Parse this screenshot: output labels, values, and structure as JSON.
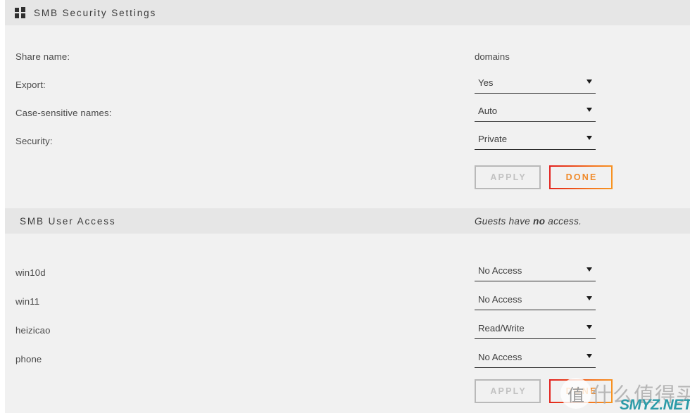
{
  "window": {
    "title": "SMB Security Settings",
    "icon": "windows-grid-icon"
  },
  "security_section": {
    "title": "SMB Security Settings",
    "rows": [
      {
        "label": "Share name:",
        "type": "text",
        "value": "domains"
      },
      {
        "label": "Export:",
        "type": "select",
        "value": "Yes"
      },
      {
        "label": "Case-sensitive names:",
        "type": "select",
        "value": "Auto"
      },
      {
        "label": "Security:",
        "type": "select",
        "value": "Private"
      }
    ],
    "apply_label": "APPLY",
    "done_label": "DONE",
    "apply_enabled": false
  },
  "users_section": {
    "title": "SMB User Access",
    "guests_note_prefix": "Guests have ",
    "guests_note_emphasis": "no",
    "guests_note_suffix": " access.",
    "rows": [
      {
        "user": "win10d",
        "access": "No Access"
      },
      {
        "user": "win11",
        "access": "No Access"
      },
      {
        "user": "heizicao",
        "access": "Read/Write"
      },
      {
        "user": "phone",
        "access": "No Access"
      }
    ],
    "apply_label": "APPLY",
    "done_label": "DONE",
    "apply_enabled": false
  },
  "watermark": {
    "badge": "值",
    "text_cn": "什么值得买",
    "site": "SMYZ.NET"
  },
  "colors": {
    "page_bg": "#f1f1f1",
    "bar_bg": "#e6e6e6",
    "text": "#4a4a4a",
    "done_border_start": "#e12020",
    "done_border_end": "#f89722",
    "done_text": "#f08a2a",
    "apply_border": "#b9b9b9",
    "apply_text": "#c2c2c2",
    "watermark_site": "#2c9ba8"
  }
}
